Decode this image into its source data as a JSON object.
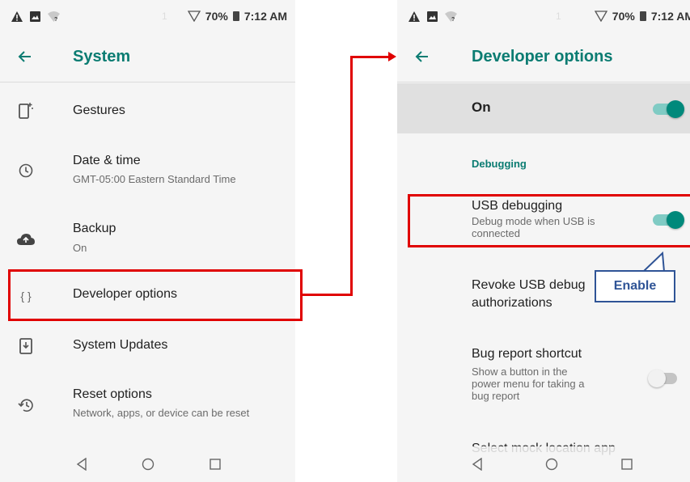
{
  "left_screen": {
    "status": {
      "battery": "70%",
      "time": "7:12 AM",
      "dim_digit": "1"
    },
    "toolbar": {
      "title": "System"
    },
    "items": [
      {
        "title": "Gestures",
        "icon": "gestures-phone-icon"
      },
      {
        "title": "Date & time",
        "subtitle": "GMT-05:00 Eastern Standard Time",
        "icon": "clock-icon"
      },
      {
        "title": "Backup",
        "subtitle": "On",
        "icon": "cloud-upload-icon"
      },
      {
        "title": "Developer options",
        "icon": "code-braces-icon",
        "icon_text": "{ }"
      },
      {
        "title": "System Updates",
        "icon": "system-update-icon"
      },
      {
        "title": "Reset options",
        "subtitle": "Network, apps, or device can be reset",
        "icon": "history-icon"
      }
    ]
  },
  "right_screen": {
    "status": {
      "battery": "70%",
      "time": "7:12 AM",
      "dim_digit": "1"
    },
    "toolbar": {
      "title": "Developer options"
    },
    "main_toggle": {
      "label": "On",
      "state": true
    },
    "section": "Debugging",
    "items": [
      {
        "title": "USB debugging",
        "subtitle_line1": "Debug mode when USB is",
        "subtitle_line2": "connected",
        "toggle": true
      },
      {
        "title_line1": "Revoke USB debug",
        "title_line2": "authorizations"
      },
      {
        "title": "Bug report shortcut",
        "subtitle_line1": "Show a button in the",
        "subtitle_line2": "power menu for taking a",
        "subtitle_line3": "bug report",
        "toggle": false
      },
      {
        "title": "Select mock location app"
      }
    ]
  },
  "annotation": {
    "callout_label": "Enable"
  },
  "colors": {
    "accent": "#0b7c72",
    "toggle_on": "#00897b",
    "highlight": "#e00000",
    "callout": "#2f5496"
  }
}
